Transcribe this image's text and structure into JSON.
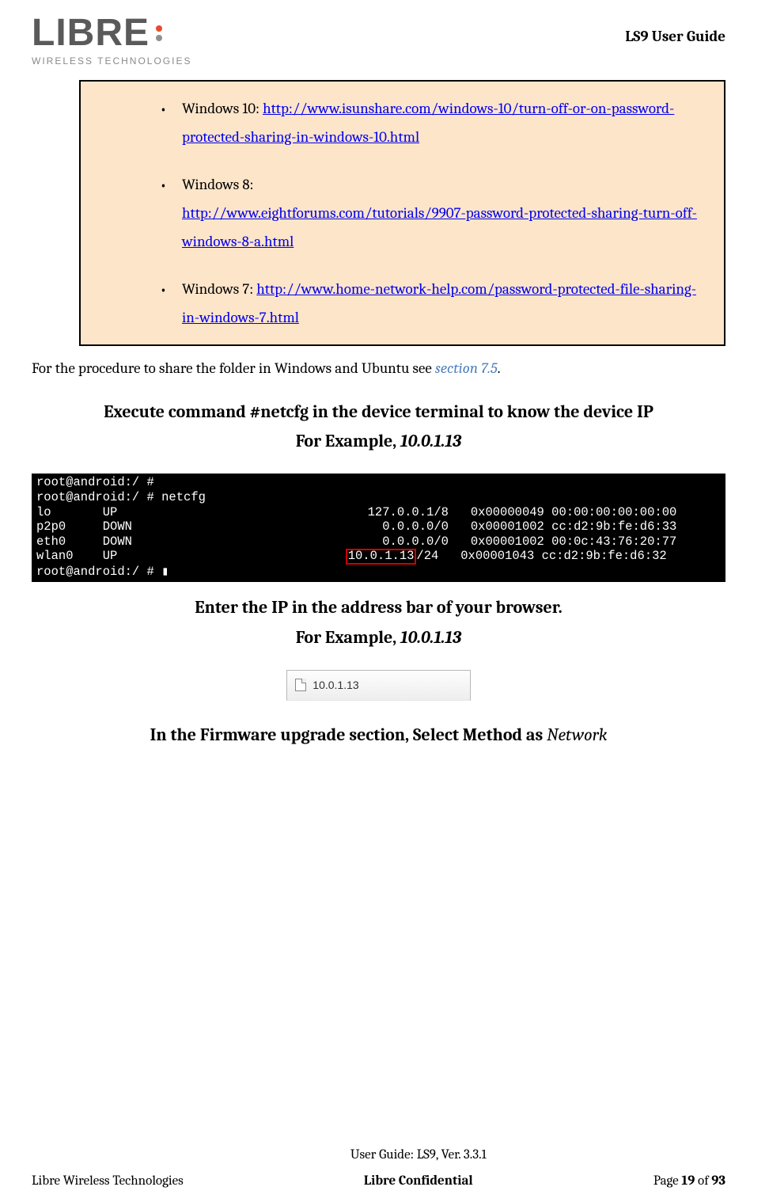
{
  "header": {
    "logo_text": "LIBRE",
    "logo_sub": "WIRELESS TECHNOLOGIES",
    "doc_title": "LS9 User Guide"
  },
  "callout": {
    "items": [
      {
        "prefix": "Windows 10: ",
        "link": "http://www.isunshare.com/windows-10/turn-off-or-on-password-protected-sharing-in-windows-10.html"
      },
      {
        "prefix": "Windows 8: ",
        "link": "http://www.eightforums.com/tutorials/9907-password-protected-sharing-turn-off-windows-8-a.html"
      },
      {
        "prefix": "Windows 7: ",
        "link": "http://www.home-network-help.com/password-protected-file-sharing-in-windows-7.html"
      }
    ]
  },
  "para1_pre": "For the procedure to share the folder in Windows and Ubuntu see ",
  "para1_ref": "section 7.5",
  "para1_post": ".",
  "step1_line1": "Execute command #netcfg in the device terminal to know the device IP",
  "step1_line2a": "For Example, ",
  "step1_line2b": "10.0.1.13",
  "terminal": {
    "line0": "root@android:/ #",
    "cmd": "root@android:/ # netcfg",
    "rows": [
      {
        "if": "lo",
        "st": "UP",
        "ip": "127.0.0.1/8",
        "hex": "0x00000049",
        "mac": "00:00:00:00:00:00"
      },
      {
        "if": "p2p0",
        "st": "DOWN",
        "ip": "0.0.0.0/0",
        "hex": "0x00001002",
        "mac": "cc:d2:9b:fe:d6:33"
      },
      {
        "if": "eth0",
        "st": "DOWN",
        "ip": "0.0.0.0/0",
        "hex": "0x00001002",
        "mac": "00:0c:43:76:20:77"
      },
      {
        "if": "wlan0",
        "st": "UP",
        "ip_hl": "10.0.1.13",
        "ip_suffix": "/24",
        "hex": "0x00001043",
        "mac": "cc:d2:9b:fe:d6:32"
      }
    ],
    "prompt": "root@android:/ # ",
    "cursor": "▮"
  },
  "step2_line1": "Enter the IP in the address bar of your browser.",
  "step2_line2a": "For Example, ",
  "step2_line2b": "10.0.1.13",
  "browser_tab_text": "10.0.1.13",
  "step3_a": "In the Firmware upgrade section, Select Method as ",
  "step3_b": "Network",
  "footer": {
    "left": "Libre Wireless Technologies",
    "center1": "User Guide: LS9, Ver. 3.3.1",
    "center2": "Libre Confidential",
    "right_pre": "Page ",
    "right_cur": "19",
    "right_mid": " of ",
    "right_tot": "93"
  }
}
